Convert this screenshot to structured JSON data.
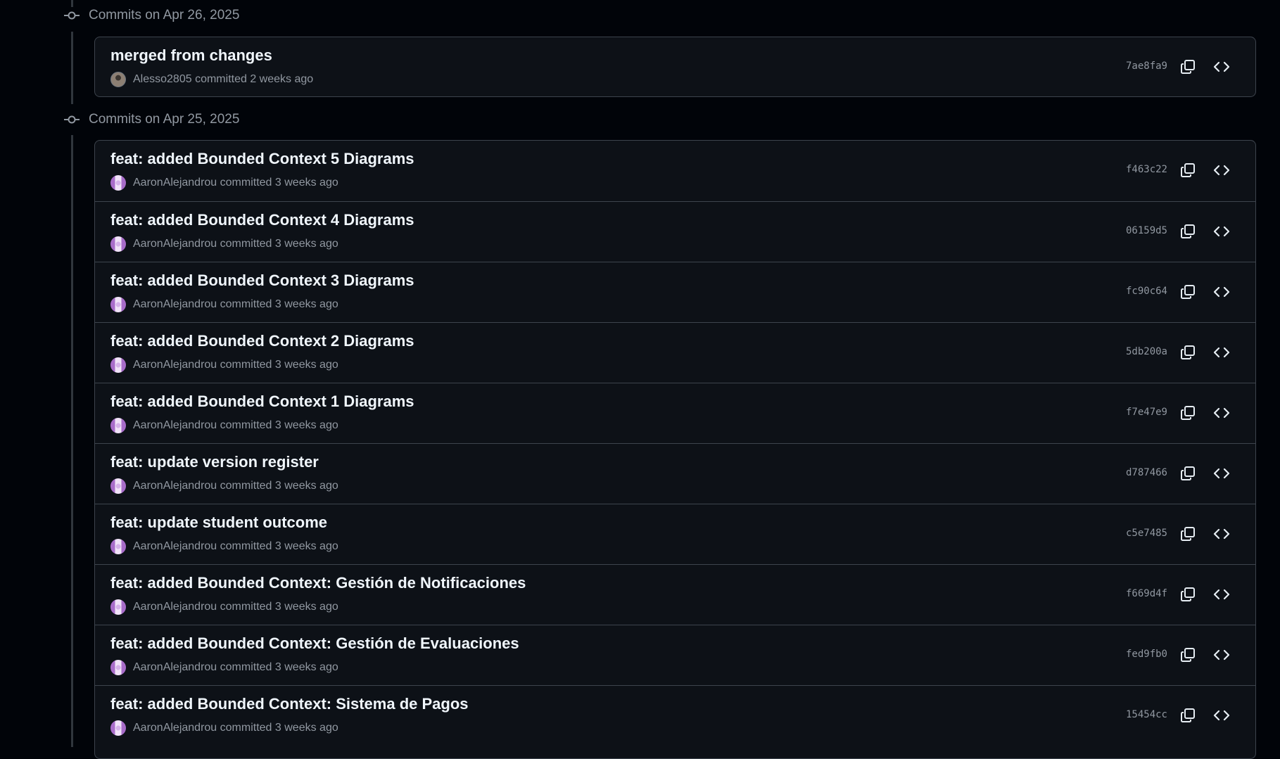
{
  "groups": [
    {
      "title": "Commits on Apr 26, 2025",
      "commits": [
        {
          "message": "merged from changes",
          "author": "Alesso2805",
          "meta": "committed 2 weeks ago",
          "sha": "7ae8fa9",
          "avatar": "photo"
        }
      ]
    },
    {
      "title": "Commits on Apr 25, 2025",
      "commits": [
        {
          "message": "feat: added Bounded Context 5 Diagrams",
          "author": "AaronAlejandrou",
          "meta": "committed 3 weeks ago",
          "sha": "f463c22",
          "avatar": "identicon"
        },
        {
          "message": "feat: added Bounded Context 4 Diagrams",
          "author": "AaronAlejandrou",
          "meta": "committed 3 weeks ago",
          "sha": "06159d5",
          "avatar": "identicon"
        },
        {
          "message": "feat: added Bounded Context 3 Diagrams",
          "author": "AaronAlejandrou",
          "meta": "committed 3 weeks ago",
          "sha": "fc90c64",
          "avatar": "identicon"
        },
        {
          "message": "feat: added Bounded Context 2 Diagrams",
          "author": "AaronAlejandrou",
          "meta": "committed 3 weeks ago",
          "sha": "5db200a",
          "avatar": "identicon"
        },
        {
          "message": "feat: added Bounded Context 1 Diagrams",
          "author": "AaronAlejandrou",
          "meta": "committed 3 weeks ago",
          "sha": "f7e47e9",
          "avatar": "identicon"
        },
        {
          "message": "feat: update version register",
          "author": "AaronAlejandrou",
          "meta": "committed 3 weeks ago",
          "sha": "d787466",
          "avatar": "identicon"
        },
        {
          "message": "feat: update student outcome",
          "author": "AaronAlejandrou",
          "meta": "committed 3 weeks ago",
          "sha": "c5e7485",
          "avatar": "identicon"
        },
        {
          "message": "feat: added Bounded Context: Gestión de Notificaciones",
          "author": "AaronAlejandrou",
          "meta": "committed 3 weeks ago",
          "sha": "f669d4f",
          "avatar": "identicon"
        },
        {
          "message": "feat: added Bounded Context: Gestión de Evaluaciones",
          "author": "AaronAlejandrou",
          "meta": "committed 3 weeks ago",
          "sha": "fed9fb0",
          "avatar": "identicon"
        },
        {
          "message": "feat: added Bounded Context: Sistema de Pagos",
          "author": "AaronAlejandrou",
          "meta": "committed 3 weeks ago",
          "sha": "15454cc",
          "avatar": "identicon"
        }
      ]
    }
  ],
  "icons": {
    "group_node": "git-commit-icon",
    "copy": "copy-icon",
    "browse": "code-icon"
  },
  "colors": {
    "background": "#010409",
    "card": "#0d1117",
    "border": "#3d444d",
    "text_primary": "#f0f6fc",
    "text_muted": "#9198a1"
  }
}
